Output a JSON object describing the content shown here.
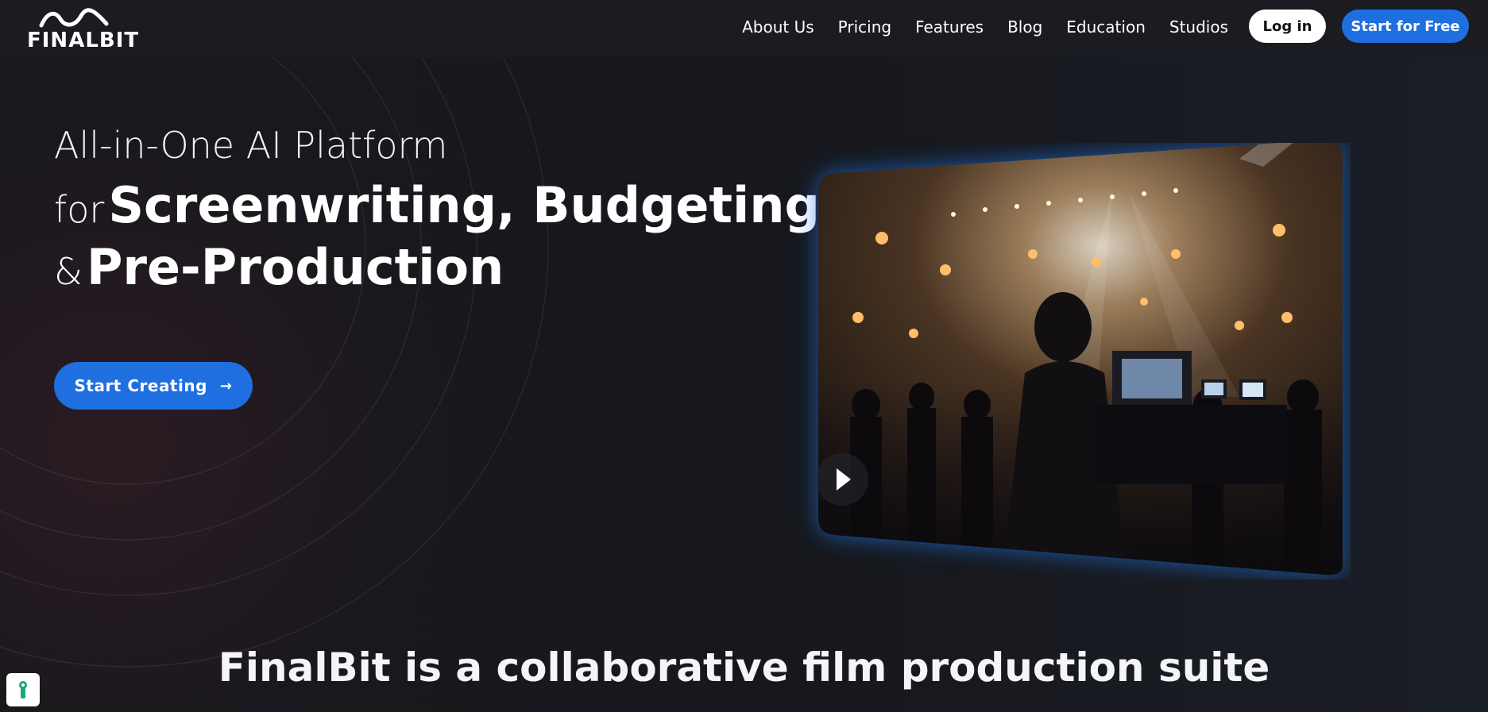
{
  "brand": {
    "name": "FINALBIT"
  },
  "nav": {
    "links": [
      "About Us",
      "Pricing",
      "Features",
      "Blog",
      "Education",
      "Studios"
    ],
    "login_label": "Log in",
    "cta_label": "Start for Free"
  },
  "hero": {
    "line1": "All-in-One AI Platform",
    "line2_lead": "for",
    "line2_strong": "Screenwriting, Budgeting",
    "line3_lead": "&",
    "line3_strong": "Pre-Production",
    "button_label": "Start Creating",
    "button_icon": "arrow-right-icon"
  },
  "video": {
    "play_icon": "play-icon",
    "accent_color": "#1f6fe0"
  },
  "section": {
    "headline": "FinalBit is a collaborative film production suite"
  },
  "colors": {
    "background": "#17181d",
    "primary": "#1f6fe0",
    "badge_accent": "#1aa877"
  }
}
